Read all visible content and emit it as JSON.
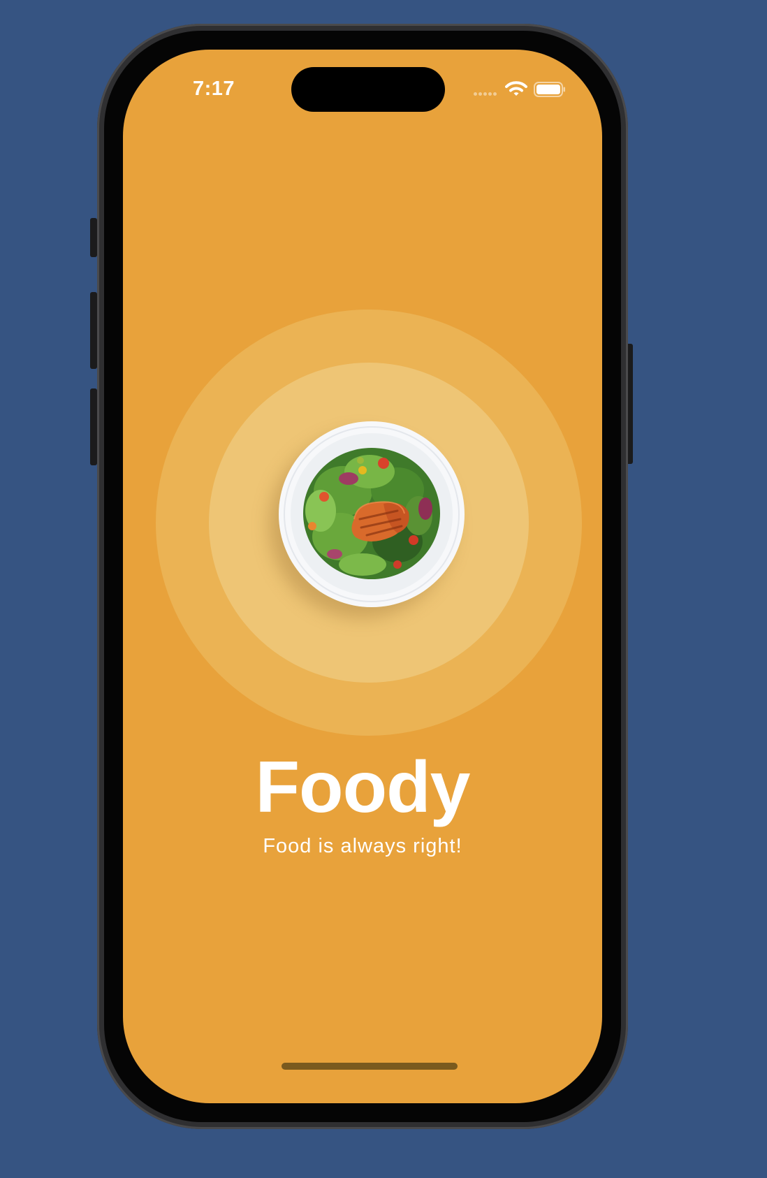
{
  "status_bar": {
    "time": "7:17",
    "icons": [
      "cellular-signal-icon",
      "wifi-icon",
      "battery-icon"
    ]
  },
  "splash": {
    "title": "Foody",
    "tagline": "Food is always right!",
    "image": "salmon-salad-plate"
  },
  "colors": {
    "background": "#365482",
    "screen": "#e8a23b",
    "outer_ring": "#ebb354",
    "inner_ring": "#eec575",
    "text": "#ffffff"
  }
}
